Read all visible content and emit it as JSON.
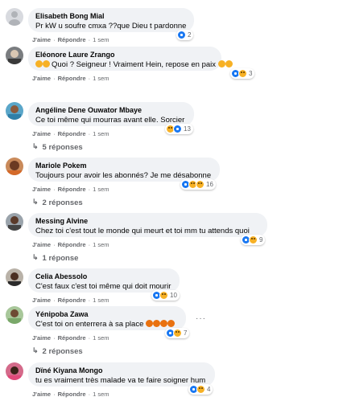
{
  "comments": [
    {
      "author": "Elisabeth Bong Mial",
      "text": "Pr kW u soufre cmxa ??que Dieu t pardonne",
      "like": "J'aime",
      "reply": "Répondre",
      "time": "1 sem",
      "reaction_count": "2"
    },
    {
      "author": "Eléonore Laure Zrango",
      "text": "Quoi ? Seigneur ! Vraiment Hein, repose en paix",
      "like": "J'aime",
      "reply": "Répondre",
      "time": "1 sem",
      "reaction_count": "3"
    },
    {
      "author": "Angéline Dene Ouwator Mbaye",
      "text": "Ce toi même qui mourras avant elle. Sorcier",
      "like": "J'aime",
      "reply": "Répondre",
      "time": "1 sem",
      "reaction_count": "13",
      "replies": "5 réponses"
    },
    {
      "author": "Mariole Pokem",
      "text": "Toujours pour avoir les abonnés? Je me désabonne",
      "like": "J'aime",
      "reply": "Répondre",
      "time": "1 sem",
      "reaction_count": "16",
      "replies": "2 réponses"
    },
    {
      "author": "Messing Alvine",
      "text": "Chez toi c'est tout le monde qui meurt et toi mm tu attends quoi",
      "like": "J'aime",
      "reply": "Répondre",
      "time": "1 sem",
      "reaction_count": "9",
      "replies": "1 réponse"
    },
    {
      "author": "Celia Abessolo",
      "text": "C'est faux c'est toi même qui doit mourir",
      "like": "J'aime",
      "reply": "Répondre",
      "time": "1 sem",
      "reaction_count": "10"
    },
    {
      "author": "Yénipoba Zawa",
      "text": "C'est toi on enterrera à sa place",
      "like": "J'aime",
      "reply": "Répondre",
      "time": "1 sem",
      "reaction_count": "7",
      "replies": "2 réponses"
    },
    {
      "author": "Dïné Kiyana Mongo",
      "text": "tu es vraiment très malade va te faire soigner hum",
      "like": "J'aime",
      "reply": "Répondre",
      "time": "1 sem",
      "reaction_count": "4"
    }
  ],
  "colors": {
    "bubble": "#f0f2f5",
    "secondary_text": "#65676b",
    "like_blue": "#1877f2",
    "emoji_yellow": "#f7b125"
  },
  "icons": [
    "like-icon",
    "haha-icon",
    "sad-icon",
    "wow-icon",
    "more-icon",
    "reply-arrow-icon"
  ]
}
